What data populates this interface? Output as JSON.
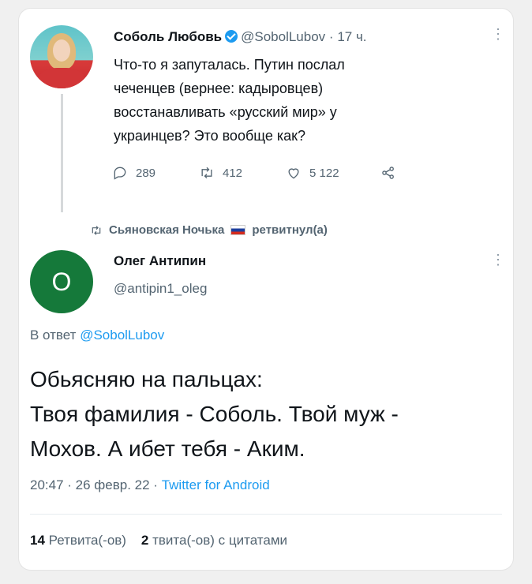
{
  "tweet1": {
    "name": "Соболь Любовь",
    "handle": "@SobolLubov",
    "separator": "·",
    "time": "17 ч.",
    "text": "Что-то я запуталась. Путин послал\nчеченцев (вернее: кадыровцев)\nвосстанавливать «русский мир» у\nукраинцев? Это вообще как?",
    "replies": "289",
    "retweets": "412",
    "likes": "5 122"
  },
  "retweet_banner": {
    "user": "Сьяновская Ночька",
    "action": "ретвитнул(а)"
  },
  "tweet2": {
    "avatar_letter": "O",
    "name": "Олег Антипин",
    "handle": "@antipin1_oleg",
    "reply_prefix": "В ответ",
    "reply_to": "@SobolLubov",
    "text": "Обьясняю на пальцах:\nТвоя фамилия - Соболь. Твой муж -\nМохов. А ибет тебя - Аким.",
    "time": "20:47 · 26 февр. 22 ·",
    "source": "Twitter for Android",
    "retweet_count": "14",
    "retweet_label": "Ретвита(-ов)",
    "quote_count": "2",
    "quote_label": "твита(-ов) с цитатами"
  },
  "icons": {
    "more": "more-icon",
    "reply": "reply-icon",
    "retweet": "retweet-icon",
    "like": "heart-icon",
    "share": "share-icon",
    "verified": "verified-badge-icon"
  },
  "colors": {
    "accent": "#1d9bf0",
    "muted": "#536471",
    "avatar_green": "#15793a"
  }
}
